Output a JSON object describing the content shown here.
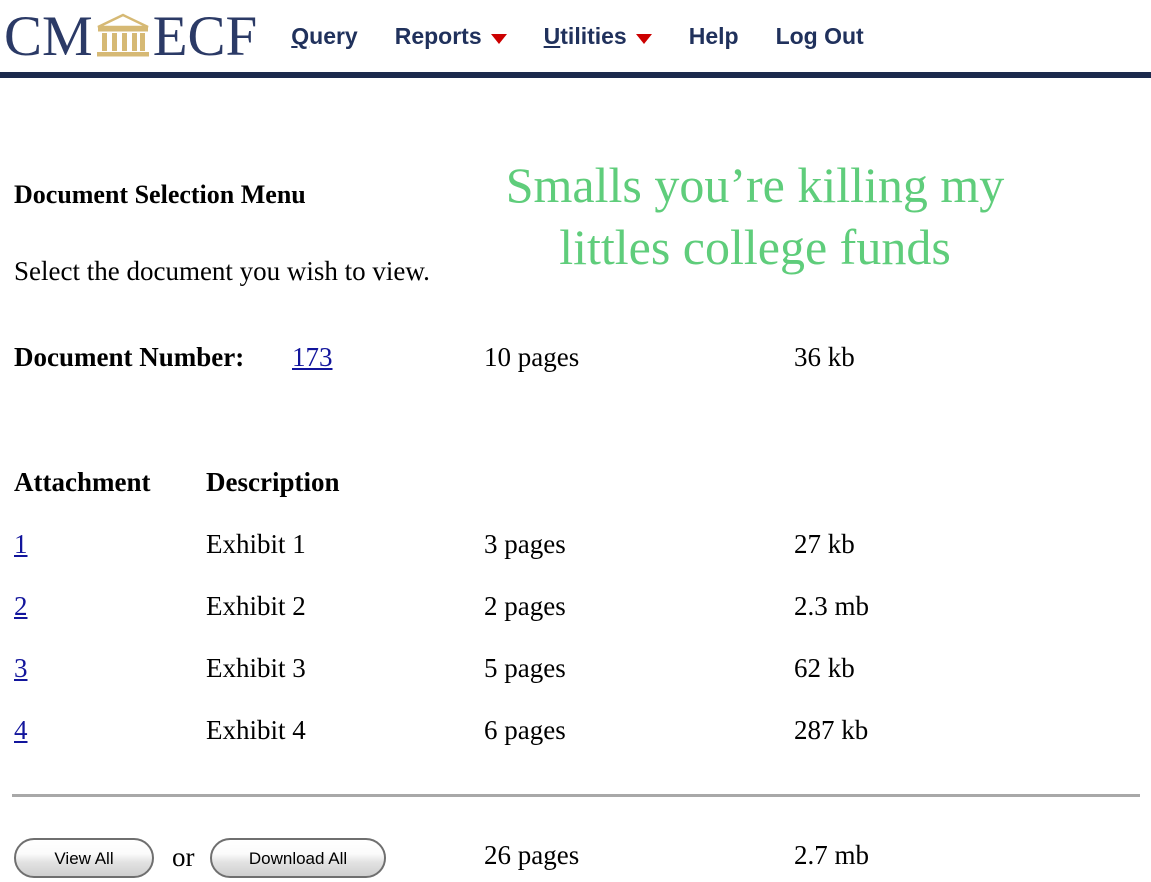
{
  "header": {
    "logo": {
      "left_text": "CM",
      "right_text": "ECF",
      "icon": "courthouse-icon",
      "navy": "#2b3a66",
      "gold": "#d6b974"
    },
    "nav": [
      {
        "label": "Query",
        "accesskey": "Q",
        "has_dropdown": false
      },
      {
        "label": "Reports",
        "accesskey": "",
        "has_dropdown": true
      },
      {
        "label": "Utilities",
        "accesskey": "U",
        "has_dropdown": true
      },
      {
        "label": "Help",
        "accesskey": "",
        "has_dropdown": false
      },
      {
        "label": "Log Out",
        "accesskey": "",
        "has_dropdown": false
      }
    ],
    "rule_color": "#1c2a4d"
  },
  "main": {
    "title": "Document Selection Menu",
    "instruction": "Select the document you wish to view.",
    "overlay_note": "Smalls you’re killing my littles college funds",
    "overlay_note_color": "#5fcd7b",
    "document": {
      "label": "Document Number:",
      "number": "173",
      "pages": "10 pages",
      "size": "36 kb",
      "link_color": "#12159c"
    },
    "table": {
      "headers": {
        "attachment": "Attachment",
        "description": "Description",
        "pages": "",
        "size": ""
      },
      "rows": [
        {
          "attachment": "1",
          "description": "Exhibit 1",
          "pages": "3 pages",
          "size": "27 kb"
        },
        {
          "attachment": "2",
          "description": "Exhibit 2",
          "pages": "2 pages",
          "size": "2.3 mb"
        },
        {
          "attachment": "3",
          "description": "Exhibit 3",
          "pages": "5 pages",
          "size": "62 kb"
        },
        {
          "attachment": "4",
          "description": "Exhibit 4",
          "pages": "6 pages",
          "size": "287 kb"
        }
      ]
    },
    "footer": {
      "view_all_label": "View All",
      "or_label": "or",
      "download_all_label": "Download All",
      "total_pages": "26 pages",
      "total_size": "2.7 mb"
    }
  }
}
